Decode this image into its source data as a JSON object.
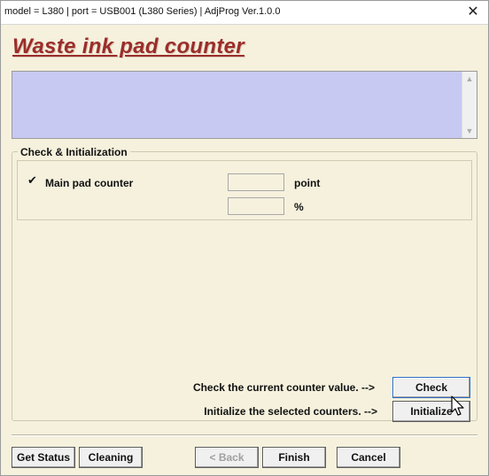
{
  "titlebar": {
    "title": "model = L380 | port = USB001 (L380 Series) | AdjProg Ver.1.0.0",
    "close_label": "✕"
  },
  "heading": "Waste ink pad counter",
  "group": {
    "title": "Check & Initialization",
    "main_pad": {
      "checked": true,
      "check_mark": "✔",
      "label": "Main pad counter",
      "point_value": "",
      "percent_value": "",
      "unit_point": "point",
      "unit_percent": "%"
    }
  },
  "actions": {
    "check_hint": "Check the current counter value. -->",
    "check_label": "Check",
    "init_hint": "Initialize the selected counters. -->",
    "init_label": "Initialize"
  },
  "footer": {
    "get_status": "Get Status",
    "cleaning": "Cleaning",
    "back": "< Back",
    "finish": "Finish",
    "cancel": "Cancel"
  },
  "colors": {
    "heading": "#9b2d2a",
    "info_box": "#c8c9f2",
    "background": "#f5f1dd"
  },
  "icons": {
    "scroll_up": "scroll-up-icon",
    "scroll_down": "scroll-down-icon",
    "cursor": "mouse-pointer-icon"
  }
}
